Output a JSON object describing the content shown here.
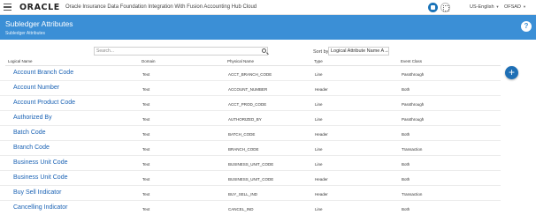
{
  "topbar": {
    "logo": "ORACLE",
    "app_title": "Oracle Insurance Data Foundation Integration With Fusion Accounting Hub Cloud",
    "language": "US-English",
    "user": "OFSAD"
  },
  "header": {
    "title": "Subledger Attributes",
    "subtitle": "Subledger Attributes",
    "help": "?"
  },
  "toolbar": {
    "search_placeholder": "Search...",
    "sort_label": "Sort by",
    "sort_value": "Logical Attribute Name A→Z"
  },
  "columns": {
    "logical": "Logical Name",
    "domain": "Domain",
    "physical": "Physical Name",
    "type": "Type",
    "event": "Event Class"
  },
  "rows": [
    {
      "logical": "Account Branch Code",
      "domain": "Text",
      "physical": "ACCT_BRANCH_CODE",
      "type": "Line",
      "event": "Passthrough"
    },
    {
      "logical": "Account Number",
      "domain": "Text",
      "physical": "ACCOUNT_NUMBER",
      "type": "Header",
      "event": "Both"
    },
    {
      "logical": "Account Product Code",
      "domain": "Text",
      "physical": "ACCT_PROD_CODE",
      "type": "Line",
      "event": "Passthrough"
    },
    {
      "logical": "Authorized By",
      "domain": "Text",
      "physical": "AUTHORIZED_BY",
      "type": "Line",
      "event": "Passthrough"
    },
    {
      "logical": "Batch Code",
      "domain": "Text",
      "physical": "BATCH_CODE",
      "type": "Header",
      "event": "Both"
    },
    {
      "logical": "Branch Code",
      "domain": "Text",
      "physical": "BRANCH_CODE",
      "type": "Line",
      "event": "Transaction"
    },
    {
      "logical": "Business Unit Code",
      "domain": "Text",
      "physical": "BUSINESS_UNIT_CODE",
      "type": "Line",
      "event": "Both"
    },
    {
      "logical": "Business Unit Code",
      "domain": "Text",
      "physical": "BUSINESS_UNIT_CODE",
      "type": "Header",
      "event": "Both"
    },
    {
      "logical": "Buy Sell Indicator",
      "domain": "Text",
      "physical": "BUY_SELL_IND",
      "type": "Header",
      "event": "Transaction"
    },
    {
      "logical": "Cancelling Indicator",
      "domain": "Text",
      "physical": "CANCEL_IND",
      "type": "Line",
      "event": "Both"
    }
  ],
  "fab": "+"
}
